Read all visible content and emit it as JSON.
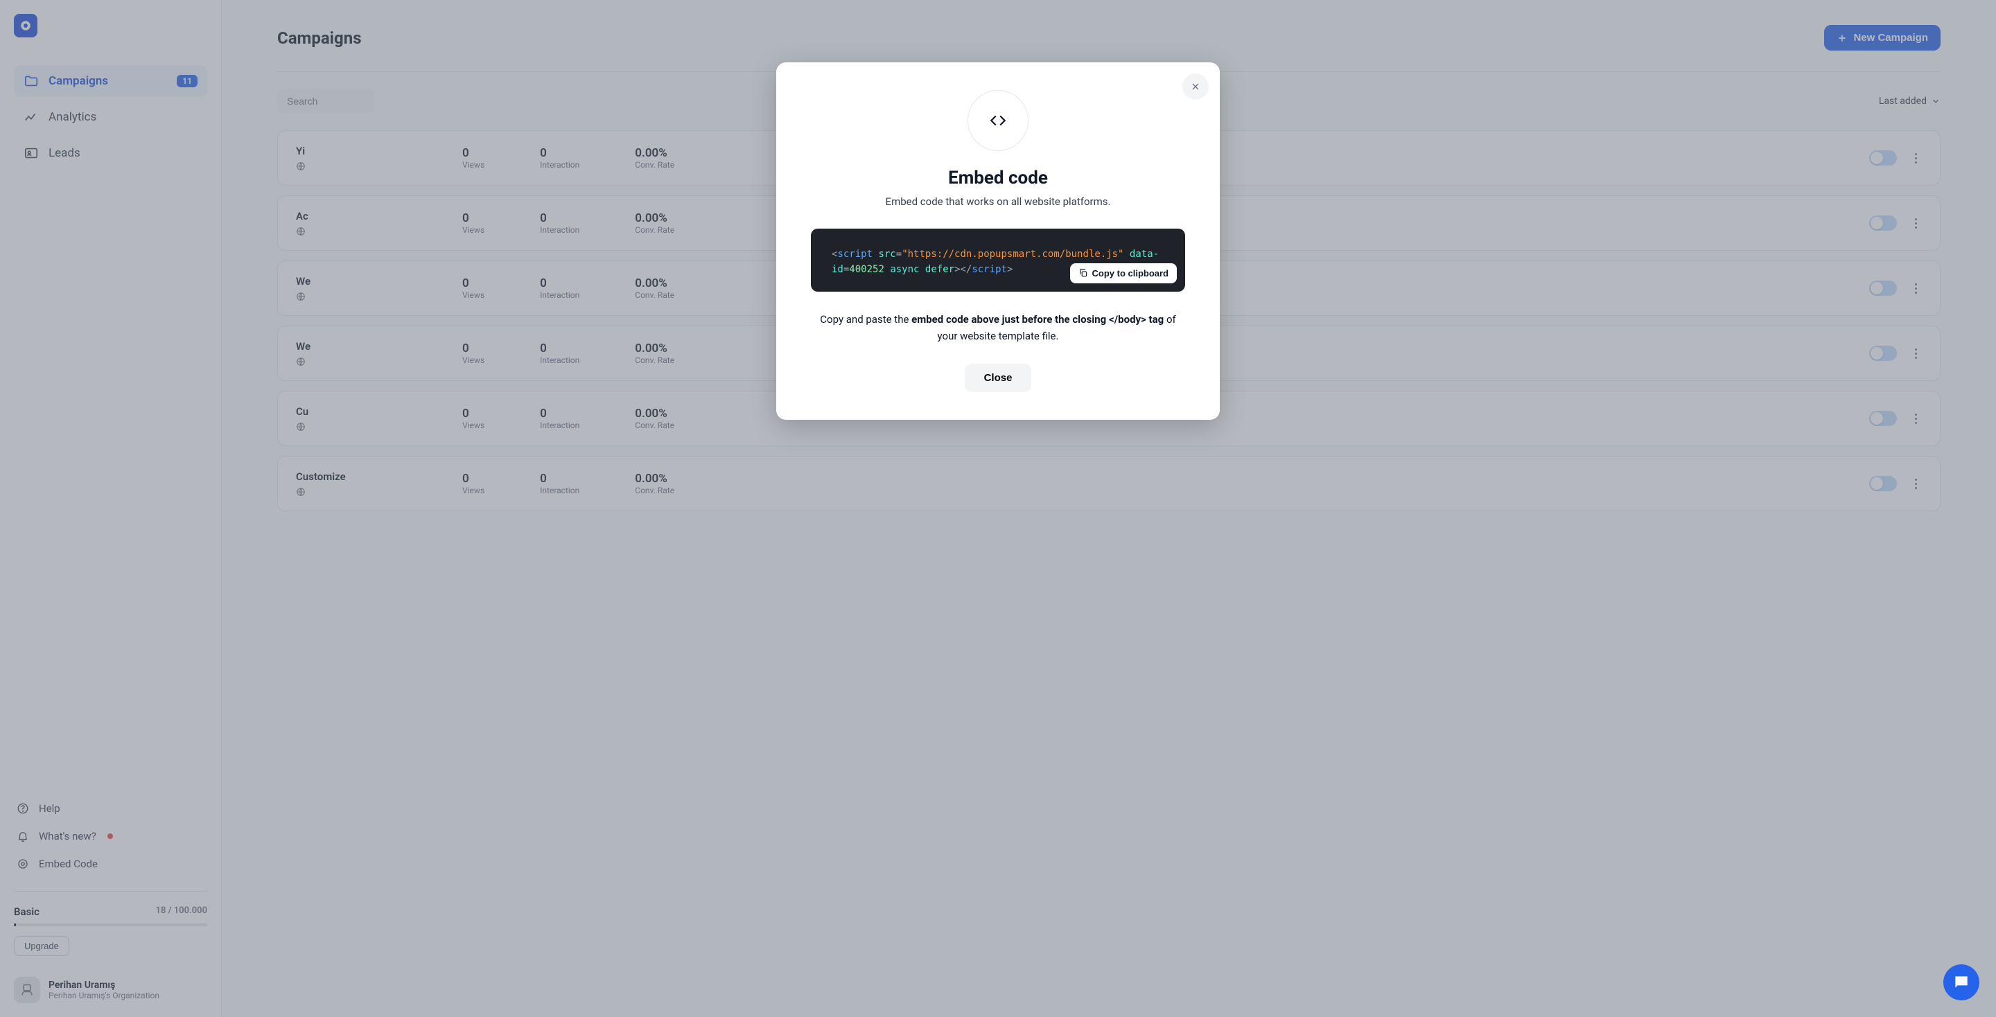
{
  "sidebar": {
    "nav": {
      "campaigns": {
        "label": "Campaigns",
        "badge": "11"
      },
      "analytics": {
        "label": "Analytics"
      },
      "leads": {
        "label": "Leads"
      }
    },
    "help": {
      "label": "Help"
    },
    "whatsnew": {
      "label": "What's new?"
    },
    "embed": {
      "label": "Embed Code"
    },
    "plan": {
      "name": "Basic",
      "usage": "18 / 100.000",
      "upgrade": "Upgrade"
    },
    "user": {
      "name": "Perihan Uramış",
      "org": "Perihan Uramış's Organization"
    }
  },
  "header": {
    "title": "Campaigns",
    "new_button": "New Campaign",
    "search_placeholder": "Search",
    "sort_label": "Last added"
  },
  "campaigns": [
    {
      "title": "Yi",
      "views": "0",
      "views_label": "Views",
      "interaction": "0",
      "interaction_label": "Interaction",
      "conv": "0.00%",
      "conv_label": "Conv. Rate"
    },
    {
      "title": "Ac",
      "views": "0",
      "views_label": "Views",
      "interaction": "0",
      "interaction_label": "Interaction",
      "conv": "0.00%",
      "conv_label": "Conv. Rate"
    },
    {
      "title": "We",
      "views": "0",
      "views_label": "Views",
      "interaction": "0",
      "interaction_label": "Interaction",
      "conv": "0.00%",
      "conv_label": "Conv. Rate"
    },
    {
      "title": "We",
      "views": "0",
      "views_label": "Views",
      "interaction": "0",
      "interaction_label": "Interaction",
      "conv": "0.00%",
      "conv_label": "Conv. Rate"
    },
    {
      "title": "Cu",
      "views": "0",
      "views_label": "Views",
      "interaction": "0",
      "interaction_label": "Interaction",
      "conv": "0.00%",
      "conv_label": "Conv. Rate"
    },
    {
      "title": "Customize",
      "views": "0",
      "views_label": "Views",
      "interaction": "0",
      "interaction_label": "Interaction",
      "conv": "0.00%",
      "conv_label": "Conv. Rate"
    }
  ],
  "modal": {
    "title": "Embed code",
    "subtitle": "Embed code that works on all website platforms.",
    "code": {
      "src_url": "\"https://cdn.popupsmart.com/bundle.js\"",
      "data_id": "400252",
      "async": "async",
      "defer": "defer"
    },
    "copy_label": "Copy to clipboard",
    "instruction_prefix": "Copy and paste the ",
    "instruction_bold": "embed code above just before the closing </body> tag",
    "instruction_suffix": " of your website template file.",
    "close_label": "Close"
  }
}
